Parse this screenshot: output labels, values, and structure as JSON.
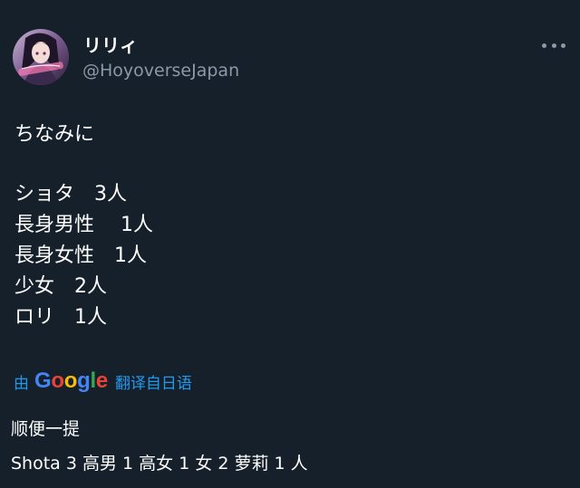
{
  "user": {
    "display_name": "リリィ",
    "handle": "@HoyoverseJapan",
    "avatar_icon": "anime-girl-avatar-icon"
  },
  "more_icon": "more-options-icon",
  "tweet": {
    "lines": [
      "ちなみに",
      "",
      "ショタ　3人",
      "長身男性　 1人",
      "長身女性　1人",
      "少女　2人",
      "ロリ　1人"
    ]
  },
  "translation": {
    "prefix": "由",
    "google_letters": [
      "G",
      "o",
      "o",
      "g",
      "l",
      "e"
    ],
    "suffix": "翻译自日语",
    "text_lines": [
      "顺便一提",
      "Shota 3 高男 1 高女 1 女 2 萝莉 1 人"
    ]
  },
  "colors": {
    "background": "#15202b",
    "text": "#ffffff",
    "secondary_text": "#8b98a5",
    "link": "#1d9bf0",
    "google_blue": "#4285f4",
    "google_red": "#ea4335",
    "google_yellow": "#fbbc05",
    "google_green": "#34a853"
  }
}
